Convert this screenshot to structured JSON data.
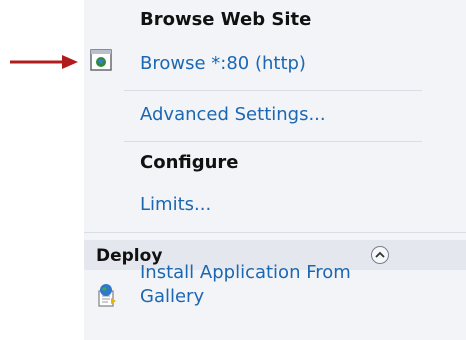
{
  "actions": {
    "browse_heading": "Browse Web Site",
    "browse_link": "Browse *:80 (http)",
    "advanced_link": "Advanced Settings...",
    "configure_heading": "Configure",
    "limits_link": "Limits...",
    "deploy_heading": "Deploy",
    "install_link_line1": "Install Application From",
    "install_link_line2": "Gallery"
  },
  "colors": {
    "link": "#1b67b3",
    "heading": "#111111",
    "arrow": "#b01c1c",
    "panel_background": "#f3f4f7",
    "section_bar": "#e4e7ed"
  },
  "icons": {
    "browse": "browser-window-globe-icon",
    "deploy_toggle": "chevron-up-icon",
    "install": "gallery-install-icon",
    "annotation": "red-arrow-icon"
  }
}
